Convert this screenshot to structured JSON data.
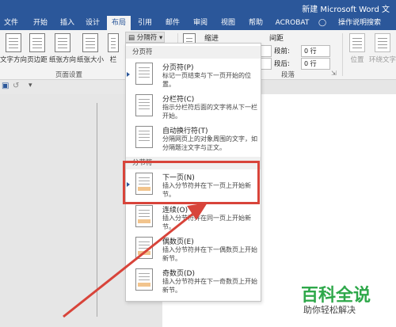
{
  "window": {
    "title": "新建 Microsoft Word 文"
  },
  "tabs": [
    {
      "label": "文件"
    },
    {
      "label": "开始"
    },
    {
      "label": "插入"
    },
    {
      "label": "设计"
    },
    {
      "label": "布局"
    },
    {
      "label": "引用"
    },
    {
      "label": "邮件"
    },
    {
      "label": "审阅"
    },
    {
      "label": "视图"
    },
    {
      "label": "帮助"
    },
    {
      "label": "ACROBAT"
    },
    {
      "label": "操作说明搜索"
    }
  ],
  "ribbon": {
    "text_direction": "文字方向",
    "margins": "页边距",
    "orientation": "纸张方向",
    "size": "纸张大小",
    "columns": "栏",
    "breaks_button": "分隔符",
    "page_setup_group": "页面设置",
    "indent_label": "缩进",
    "spacing_label": "间距",
    "before_label": "段前:",
    "before_value": "0 行",
    "after_label": "段后:",
    "after_value": "0 行",
    "paragraph_group": "段落",
    "position": "位置",
    "wrap_text": "环绕文字"
  },
  "menu": {
    "page_breaks_header": "分页符",
    "section_breaks_header": "分节符",
    "items": [
      {
        "title": "分页符(P)",
        "desc": "标记一页结束与下一页开始的位置。"
      },
      {
        "title": "分栏符(C)",
        "desc": "指示分栏符后面的文字将从下一栏开始。"
      },
      {
        "title": "自动换行符(T)",
        "desc": "分隔网页上的对象周围的文字，如分隔题注文字与正文。"
      },
      {
        "title": "下一页(N)",
        "desc": "插入分节符并在下一页上开始新节。"
      },
      {
        "title": "连续(O)",
        "desc": "插入分节符并在同一页上开始新节。"
      },
      {
        "title": "偶数页(E)",
        "desc": "插入分节符并在下一偶数页上开始新节。"
      },
      {
        "title": "奇数页(D)",
        "desc": "插入分节符并在下一奇数页上开始新节。"
      }
    ]
  },
  "watermark": {
    "brand": "百科全说",
    "tagline": "助你轻松解决"
  },
  "colors": {
    "accent": "#2b579a",
    "highlight": "#d8443a",
    "brand_green": "#2ea84a"
  }
}
